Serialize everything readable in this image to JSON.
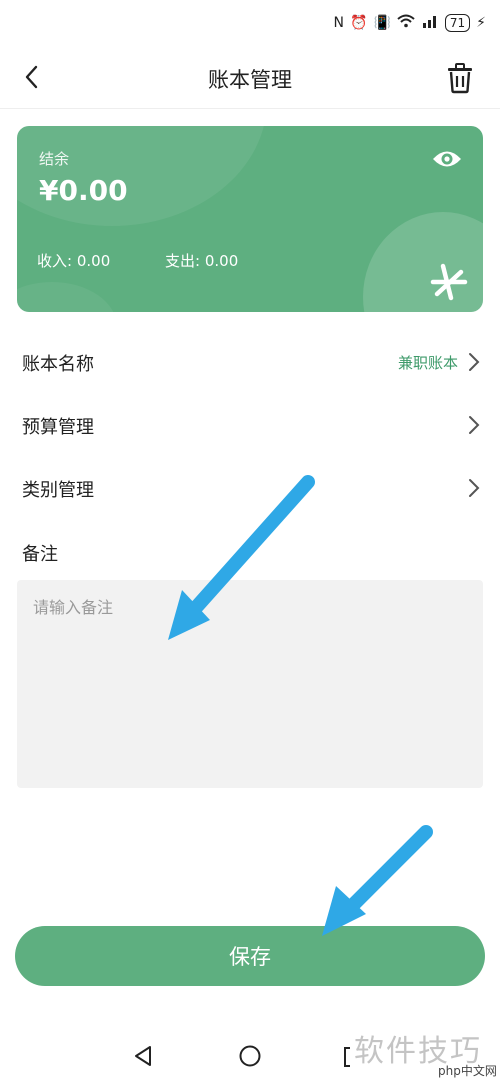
{
  "status": {
    "battery": "71"
  },
  "header": {
    "title": "账本管理"
  },
  "card": {
    "balance_label": "结余",
    "balance_value": "¥0.00",
    "income_label": "收入:",
    "income_value": "0.00",
    "expense_label": "支出:",
    "expense_value": "0.00",
    "color": "#5eaf80"
  },
  "rows": [
    {
      "label": "账本名称",
      "value": "兼职账本"
    },
    {
      "label": "预算管理"
    },
    {
      "label": "类别管理"
    }
  ],
  "note": {
    "label": "备注",
    "placeholder": "请输入备注"
  },
  "save_button": {
    "label": "保存"
  },
  "arrow_color": "#2fa8e6",
  "watermark": {
    "text": "软件技巧",
    "sub": "php中文网"
  }
}
